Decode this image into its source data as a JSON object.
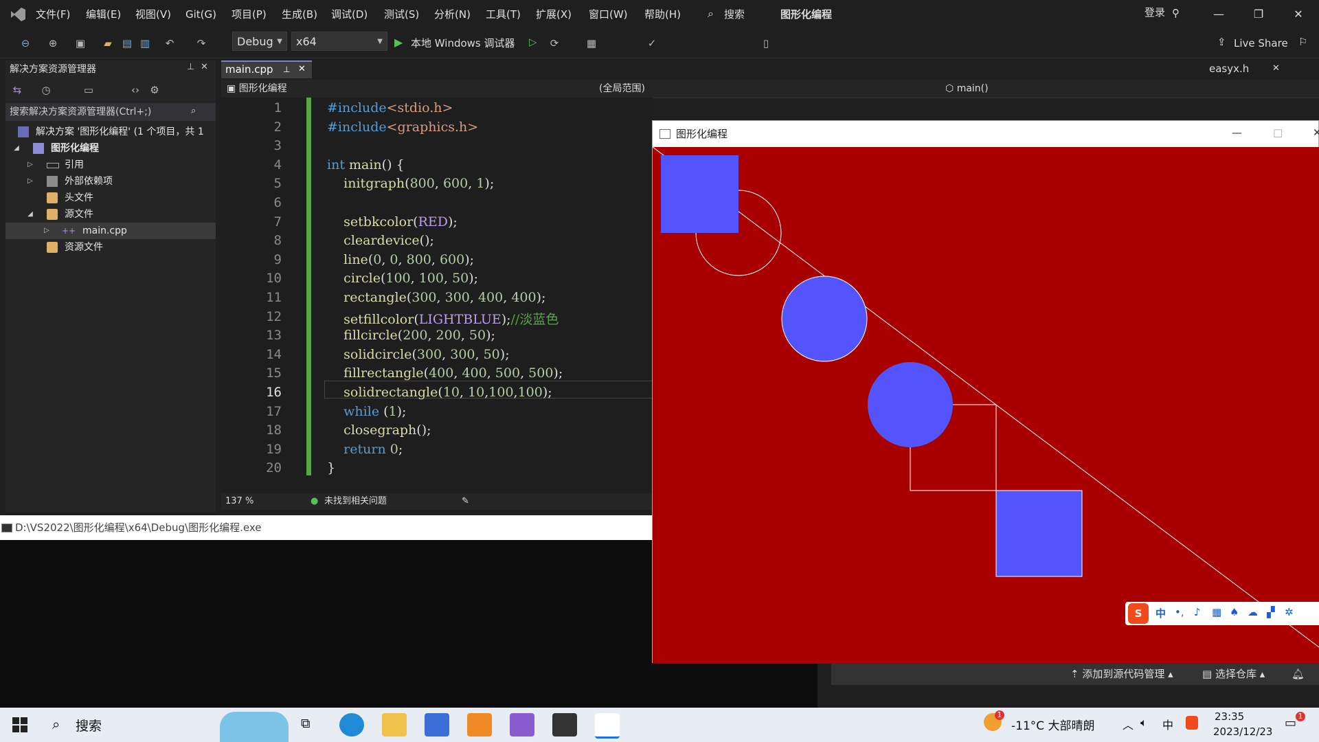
{
  "titlebar": {
    "menus": [
      "文件(F)",
      "编辑(E)",
      "视图(V)",
      "Git(G)",
      "项目(P)",
      "生成(B)",
      "调试(D)",
      "测试(S)",
      "分析(N)",
      "工具(T)",
      "扩展(X)",
      "窗口(W)",
      "帮助(H)"
    ],
    "search_label": "搜索",
    "solution_title": "图形化编程",
    "login": "登录"
  },
  "toolbar": {
    "config": "Debug",
    "platform": "x64",
    "run_label": "本地 Windows 调试器",
    "live_share": "Live Share"
  },
  "solution_explorer": {
    "title": "解决方案资源管理器",
    "search_placeholder": "搜索解决方案资源管理器(Ctrl+;)",
    "solution_node": "解决方案 '图形化编程' (1 个项目，共 1",
    "project": "图形化编程",
    "items": [
      "引用",
      "外部依赖项",
      "头文件",
      "源文件",
      "main.cpp",
      "资源文件"
    ]
  },
  "editor": {
    "tab": "main.cpp",
    "right_tab": "easyx.h",
    "nav_project": "图形化编程",
    "nav_scope": "(全局范围)",
    "nav_member": "main()",
    "lines": [
      "#include<stdio.h>",
      "#include<graphics.h>",
      "",
      "int main() {",
      "    initgraph(800, 600, 1);",
      "",
      "    setbkcolor(RED);",
      "    cleardevice();",
      "    line(0, 0, 800, 600);",
      "    circle(100, 100, 50);",
      "    rectangle(300, 300, 400, 400);",
      "    setfillcolor(LIGHTBLUE);//淡蓝色",
      "    fillcircle(200, 200, 50);",
      "    solidcircle(300, 300, 50);",
      "    fillrectangle(400, 400, 500, 500);",
      "    solidrectangle(10, 10,100,100);",
      "    while (1);",
      "    closegraph();",
      "    return 0;",
      "}"
    ],
    "current_line": 16,
    "zoom": "137 %",
    "status": "未找到相关问题"
  },
  "console": {
    "title": "D:\\VS2022\\图形化编程\\x64\\Debug\\图形化编程.exe"
  },
  "graphics_window": {
    "title": "图形化编程",
    "bg_color": "#a80000",
    "fill_color": "#5454fc"
  },
  "ime": {
    "mode": "中"
  },
  "bottom_right": {
    "add_source": "添加到源代码管理",
    "select_repo": "选择仓库"
  },
  "taskbar": {
    "search": "搜索",
    "weather": "-11°C 大部晴朗",
    "input_lang": "中",
    "time": "23:35",
    "date": "2023/12/23",
    "notification_count": "1",
    "weather_badge": "1"
  }
}
